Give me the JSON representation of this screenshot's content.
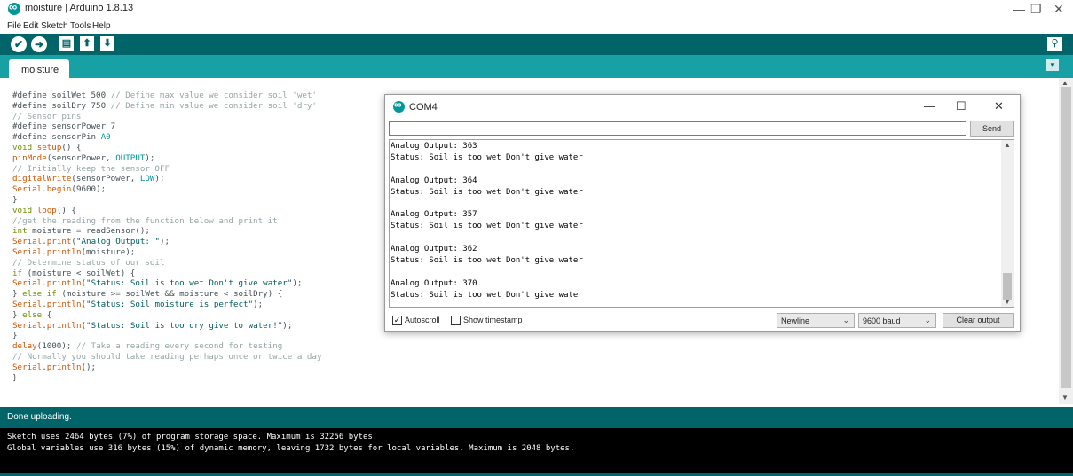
{
  "window": {
    "title": "moisture | Arduino 1.8.13",
    "minimize": "—",
    "restore": "❐",
    "close": "✕"
  },
  "menu": [
    "File",
    "Edit",
    "Sketch",
    "Tools",
    "Help"
  ],
  "toolbar": {
    "verify_icon": "✔",
    "upload_icon": "➜",
    "new_icon": "▤",
    "open_icon": "⬆",
    "save_icon": "⬇",
    "serial_monitor_icon": "⚲"
  },
  "tabs": [
    {
      "label": "moisture"
    }
  ],
  "tab_menu_icon": "▼",
  "editor": {
    "lines": [
      "#define soilWet 500 // Define max value we consider soil 'wet'",
      "#define soilDry 750 // Define min value we consider soil 'dry'",
      "// Sensor pins",
      "#define sensorPower 7",
      "#define sensorPin A0",
      "void setup() {",
      "pinMode(sensorPower, OUTPUT);",
      "// Initially keep the sensor OFF",
      "digitalWrite(sensorPower, LOW);",
      "Serial.begin(9600);",
      "}",
      "void loop() {",
      "//get the reading from the function below and print it",
      "int moisture = readSensor();",
      "Serial.print(\"Analog Output: \");",
      "Serial.println(moisture);",
      "// Determine status of our soil",
      "if (moisture < soilWet) {",
      "Serial.println(\"Status: Soil is too wet Don't give water\");",
      "} else if (moisture >= soilWet && moisture < soilDry) {",
      "Serial.println(\"Status: Soil moisture is perfect\");",
      "} else {",
      "Serial.println(\"Status: Soil is too dry give to water!\");",
      "}",
      "delay(1000); // Take a reading every second for testing",
      "// Normally you should take reading perhaps once or twice a day",
      "Serial.println();",
      "}"
    ]
  },
  "status": {
    "message": "Done uploading."
  },
  "console": {
    "lines": [
      "Sketch uses 2464 bytes (7%) of program storage space. Maximum is 32256 bytes.",
      "Global variables use 316 bytes (15%) of dynamic memory, leaving 1732 bytes for local variables. Maximum is 2048 bytes."
    ]
  },
  "serial_monitor": {
    "title": "COM4",
    "minimize": "—",
    "maximize": "☐",
    "close": "✕",
    "input_value": "",
    "send_label": "Send",
    "output_lines": [
      "Analog Output: 363",
      "Status: Soil is too wet Don't give water",
      "",
      "Analog Output: 364",
      "Status: Soil is too wet Don't give water",
      "",
      "Analog Output: 357",
      "Status: Soil is too wet Don't give water",
      "",
      "Analog Output: 362",
      "Status: Soil is too wet Don't give water",
      "",
      "Analog Output: 370",
      "Status: Soil is too wet Don't give water"
    ],
    "autoscroll_label": "Autoscroll",
    "autoscroll_checked": true,
    "timestamp_label": "Show timestamp",
    "timestamp_checked": false,
    "line_ending": "Newline",
    "baud_rate": "9600 baud",
    "clear_label": "Clear output"
  }
}
